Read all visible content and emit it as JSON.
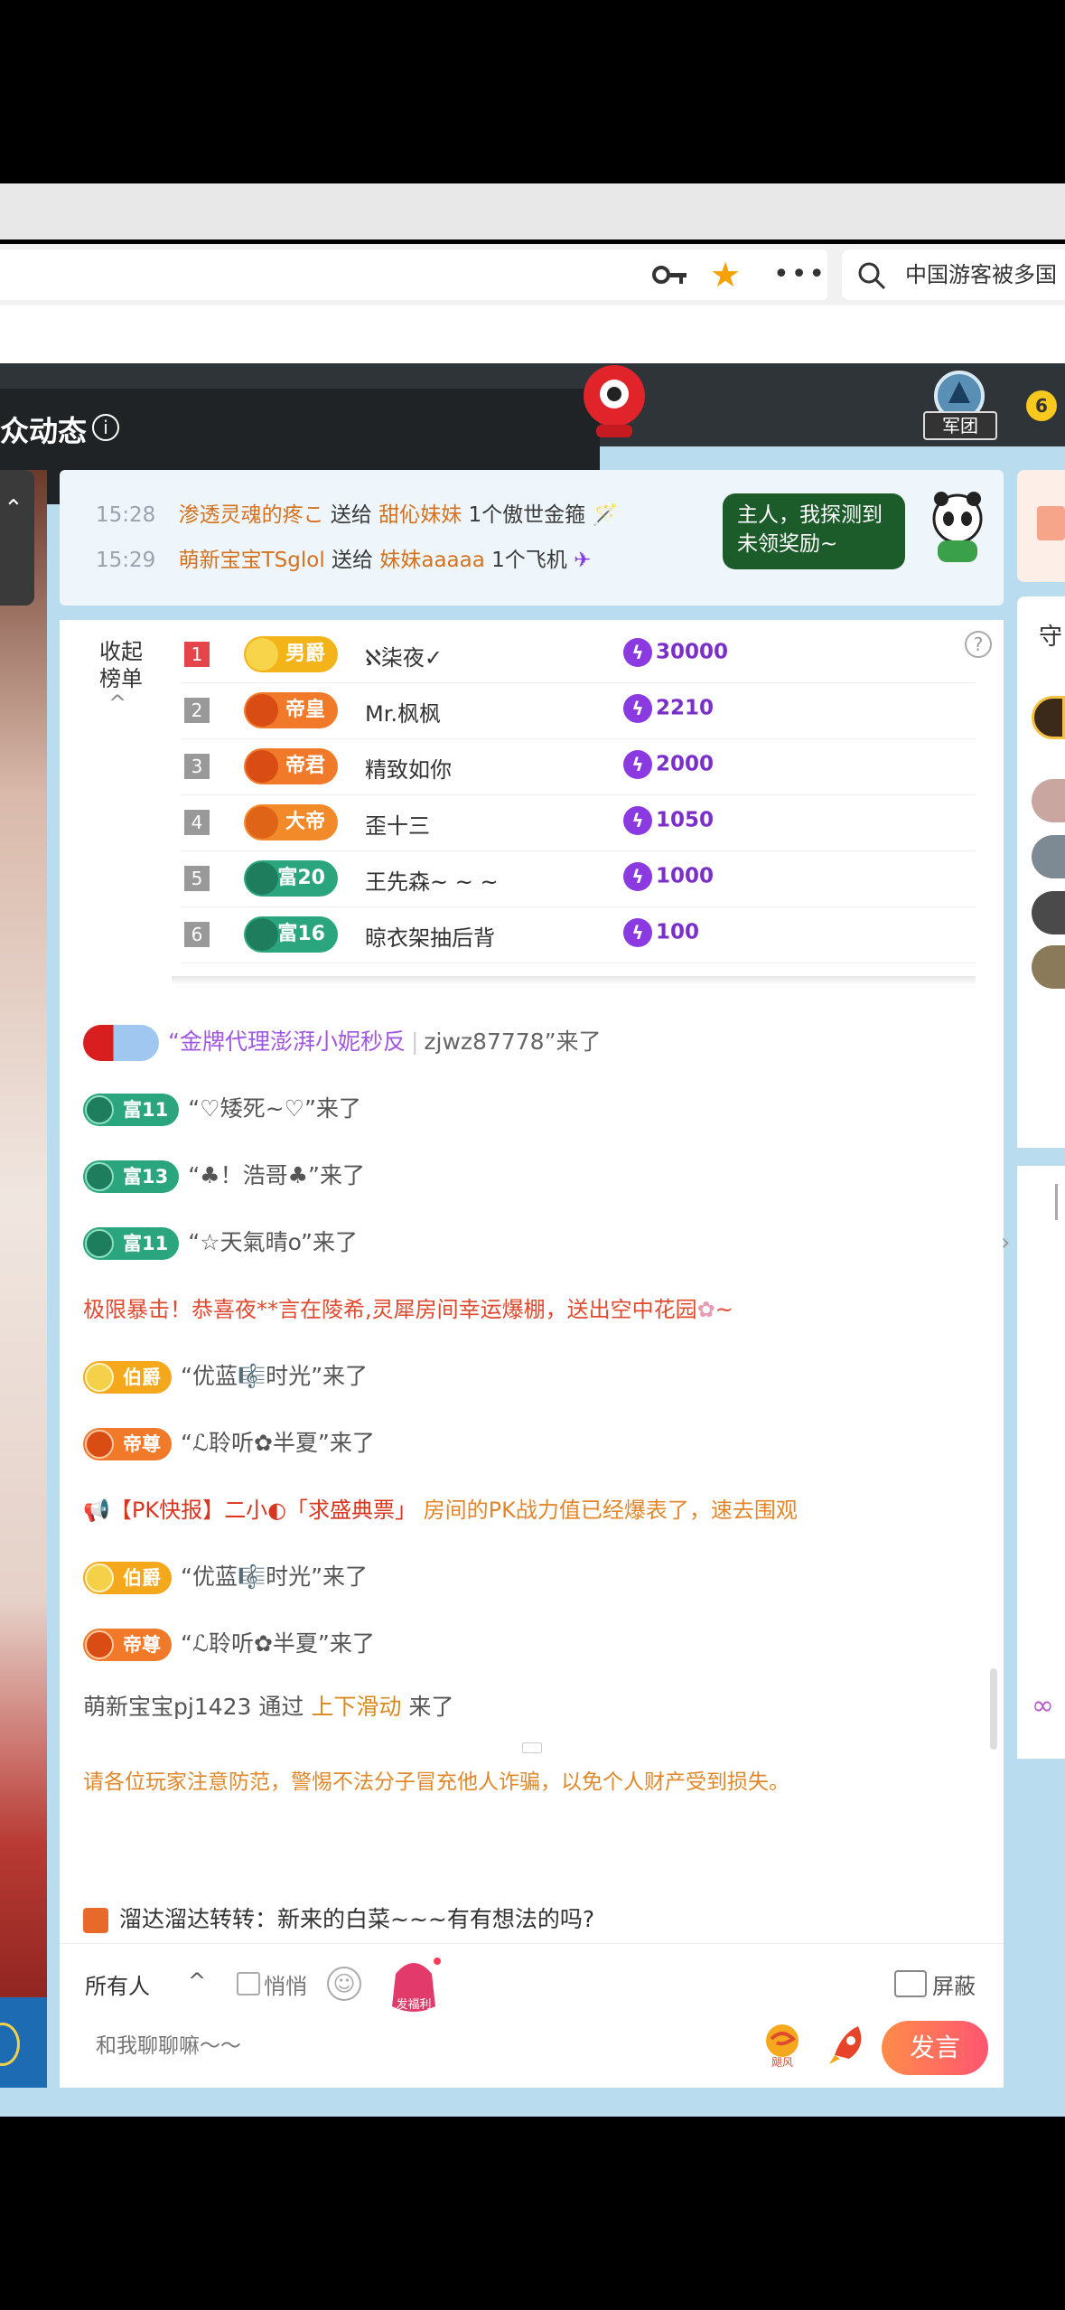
{
  "browser": {
    "search_placeholder": "中国游客被多国"
  },
  "header": {
    "notice_title": "众动态",
    "notice_info": "i",
    "legion_label": "军团",
    "coin_count": "6"
  },
  "gift_feed": [
    {
      "time": "15:28",
      "sender": "渗透灵魂的疼こ",
      "verb": "送给",
      "receiver": "甜伈妹妹",
      "gift": "1个傲世金箍"
    },
    {
      "time": "15:29",
      "sender": "萌新宝宝TSglol",
      "verb": "送给",
      "receiver": "妹妹aaaaa",
      "gift": "1个飞机"
    }
  ],
  "tip": {
    "line1": "主人，我探测到",
    "line2": "未领奖励~"
  },
  "right_sidebar": {
    "guard_label": "守"
  },
  "ranking": {
    "collapse_label": "收起榜单",
    "collapse_arrow": "^",
    "help": "?",
    "rows": [
      {
        "rank": "1",
        "badge": "男爵",
        "name": "ℵ柒夜✓",
        "score": "30000"
      },
      {
        "rank": "2",
        "badge": "帝皇",
        "name": "Mr.枫枫",
        "score": "2210"
      },
      {
        "rank": "3",
        "badge": "帝君",
        "name": "精致如你",
        "score": "2000"
      },
      {
        "rank": "4",
        "badge": "大帝",
        "name": "歪十三",
        "score": "1050"
      },
      {
        "rank": "5",
        "badge": "富20",
        "name": "王先森~ ~ ~",
        "score": "1000"
      },
      {
        "rank": "6",
        "badge": "富16",
        "name": "晾衣架抽后背",
        "score": "100"
      }
    ]
  },
  "chat": {
    "vip_msg": {
      "quote_open": "“",
      "name": "金牌代理澎湃小妮秒反",
      "sep": "|",
      "id": "zjwz87778",
      "tail": "”来了"
    },
    "rows": [
      {
        "badge": "富11",
        "text": "“♡矮死~♡”来了"
      },
      {
        "badge": "富13",
        "text": "“♣！浩哥♣”来了"
      },
      {
        "badge": "富11",
        "text": "“☆天氣晴o”来了"
      }
    ],
    "lucky": "极限暴击！恭喜夜**言在陵希,灵犀房间幸运爆棚，送出空中花园",
    "lucky_tail": "~",
    "rows2": [
      {
        "badge": "伯爵",
        "text": "“优蓝🎼时光”来了"
      },
      {
        "badge": "帝尊",
        "text": "“ℒ聆听✿半夏”来了"
      }
    ],
    "pk": {
      "prefix": "【PK快报】二小◐「求盛典票」",
      "suffix": " 房间的PK战力值已经爆表了，速去围观"
    },
    "rows3": [
      {
        "badge": "伯爵",
        "text": "“优蓝🎼时光”来了"
      },
      {
        "badge": "帝尊",
        "text": "“ℒ聆听✿半夏”来了"
      }
    ],
    "slide": {
      "user": "萌新宝宝pj1423",
      "verb": "通过",
      "action": "上下滑动",
      "tail": "来了"
    },
    "warning": "请各位玩家注意防范，警惕不法分子冒充他人诈骗，以免个人财产受到损失。",
    "broadcast": "溜达溜达转转：新来的白菜~~~有有想法的吗?"
  },
  "input": {
    "target": "所有人",
    "target_arrow": "^",
    "whisper": "悄悄",
    "emoji": "☺",
    "redpack_label": "发福利",
    "block": "屏蔽",
    "placeholder": "和我聊聊嘛～～",
    "gale_label": "飓风",
    "send": "发言"
  }
}
